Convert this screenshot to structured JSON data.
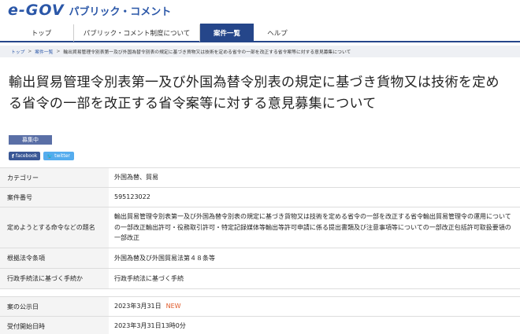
{
  "site": {
    "logo_mark": "e-GOV",
    "logo_sub": "パブリック・コメント"
  },
  "nav": {
    "items": [
      {
        "label": "トップ"
      },
      {
        "label": "パブリック・コメント制度について"
      },
      {
        "label": "案件一覧"
      },
      {
        "label": "ヘルプ"
      }
    ],
    "active_index": 2,
    "accent_color": "#25468a"
  },
  "breadcrumb": {
    "items": [
      "トップ",
      "案件一覧",
      "輸出貿易管理令別表第一及び外国為替令別表の規定に基づき貨物又は技術を定める省令の一部を改正する省令案等に対する意見募集について"
    ],
    "separator": ">"
  },
  "page": {
    "title": "輸出貿易管理令別表第一及び外国為替令別表の規定に基づき貨物又は技術を定める省令の一部を改正する省令案等に対する意見募集について",
    "status_badge": "募集中",
    "share": {
      "facebook_label": "facebook",
      "twitter_label": "twitter"
    }
  },
  "details": {
    "rows": [
      {
        "label": "カテゴリー",
        "value": "外国為替、貿易"
      },
      {
        "label": "案件番号",
        "value": "595123022"
      },
      {
        "label": "定めようとする命令などの題名",
        "value": "輸出貿易管理令別表第一及び外国為替令別表の規定に基づき貨物又は技術を定める省令の一部を改正する省令輸出貿易管理令の運用についての一部改正輸出許可・役務取引許可・特定記録媒体等輸出等許可申請に係る提出書類及び注意事項等についての一部改正包括許可取扱要領の一部改正"
      },
      {
        "label": "根拠法令条項",
        "value": "外国為替及び外国貿易法第４８条等"
      },
      {
        "label": "行政手続法に基づく手続か",
        "value": "行政手続法に基づく手続"
      }
    ],
    "dates": [
      {
        "label": "案の公示日",
        "value": "2023年3月31日",
        "tag": "NEW"
      },
      {
        "label": "受付開始日時",
        "value": "2023年3月31日13時0分"
      }
    ]
  }
}
